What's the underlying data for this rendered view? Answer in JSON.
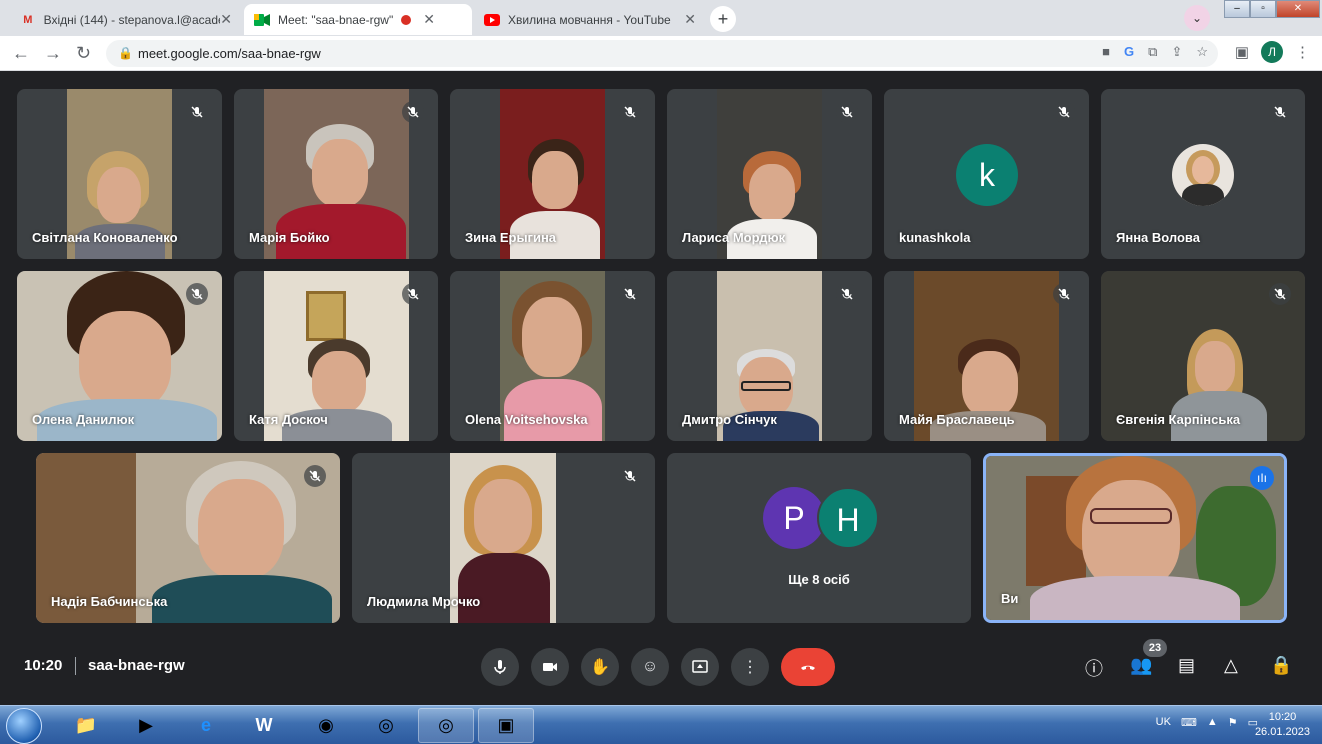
{
  "browser": {
    "tabs": [
      {
        "title": "Вхідні (144) - stepanova.l@acade",
        "icon": "gmail-icon"
      },
      {
        "title": "Meet: \"saa-bnae-rgw\"",
        "icon": "meet-icon",
        "recording": true
      },
      {
        "title": "Хвилина мовчання - YouTube",
        "icon": "youtube-icon"
      }
    ],
    "url": "meet.google.com/saa-bnae-rgw",
    "profile_initial": "Л"
  },
  "participants": [
    {
      "name": "Світлана Коноваленко"
    },
    {
      "name": "Марія Бойко"
    },
    {
      "name": "Зина Ерыгина"
    },
    {
      "name": "Лариса Мордюк"
    },
    {
      "name": "kunashkola",
      "initial": "k",
      "color": "#0b8071"
    },
    {
      "name": "Янна Волова"
    },
    {
      "name": "Олена Данилюк"
    },
    {
      "name": "Катя Доскоч"
    },
    {
      "name": "Olena Voitsehovska"
    },
    {
      "name": "Дмитро Сінчук"
    },
    {
      "name": "Майя Браславець"
    },
    {
      "name": "Євгенія Карпінська"
    },
    {
      "name": "Надія Бабчинська"
    },
    {
      "name": "Людмила Мрочко"
    },
    {
      "name": "Ще 8 осіб",
      "initials": [
        "P",
        "H"
      ],
      "colors": [
        "#5e35b1",
        "#0b8071"
      ]
    },
    {
      "name": "Ви"
    }
  ],
  "controls": {
    "time": "10:20",
    "meeting_code": "saa-bnae-rgw",
    "participant_count": "23"
  },
  "taskbar": {
    "language": "UK",
    "time": "10:20",
    "date": "26.01.2023"
  }
}
